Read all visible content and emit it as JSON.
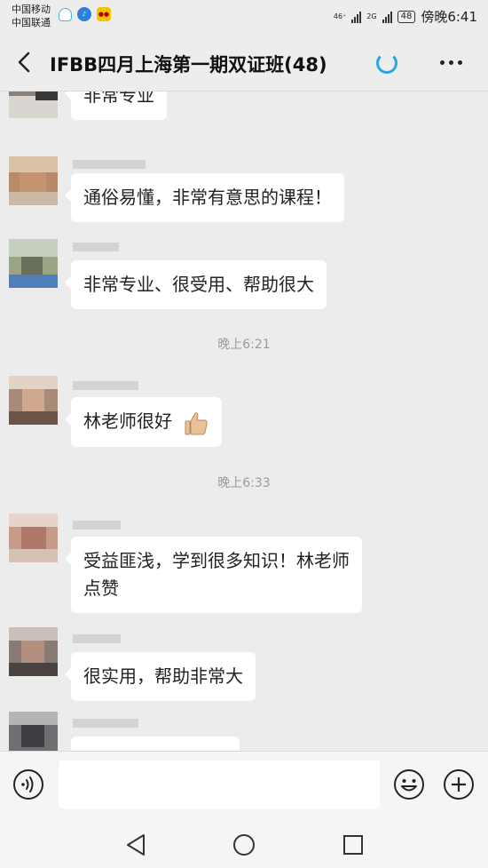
{
  "status_bar": {
    "carrier_1": "中国移动",
    "carrier_2": "中国联通",
    "net_1": "46⁺",
    "net_2": "2G",
    "battery": "48",
    "time": "傍晚6:41"
  },
  "header": {
    "title": "IFBB四月上海第一期双证班(48)"
  },
  "messages": [
    {
      "text": "非常专业"
    },
    {
      "text": "通俗易懂，非常有意思的课程！"
    },
    {
      "text": "非常专业、很受用、帮助很大"
    },
    {
      "timestamp": "晚上6:21"
    },
    {
      "text": "林老师很好",
      "emoji": "thumbs-up"
    },
    {
      "timestamp": "晚上6:33"
    },
    {
      "text_line1": "受益匪浅，学到很多知识！林老师",
      "text_line2": "点赞"
    },
    {
      "text": "很实用，帮助非常大"
    },
    {
      "text": ""
    }
  ],
  "colors": {
    "background": "#ececec",
    "bubble": "#ffffff",
    "spinner": "#2aa6dd"
  }
}
